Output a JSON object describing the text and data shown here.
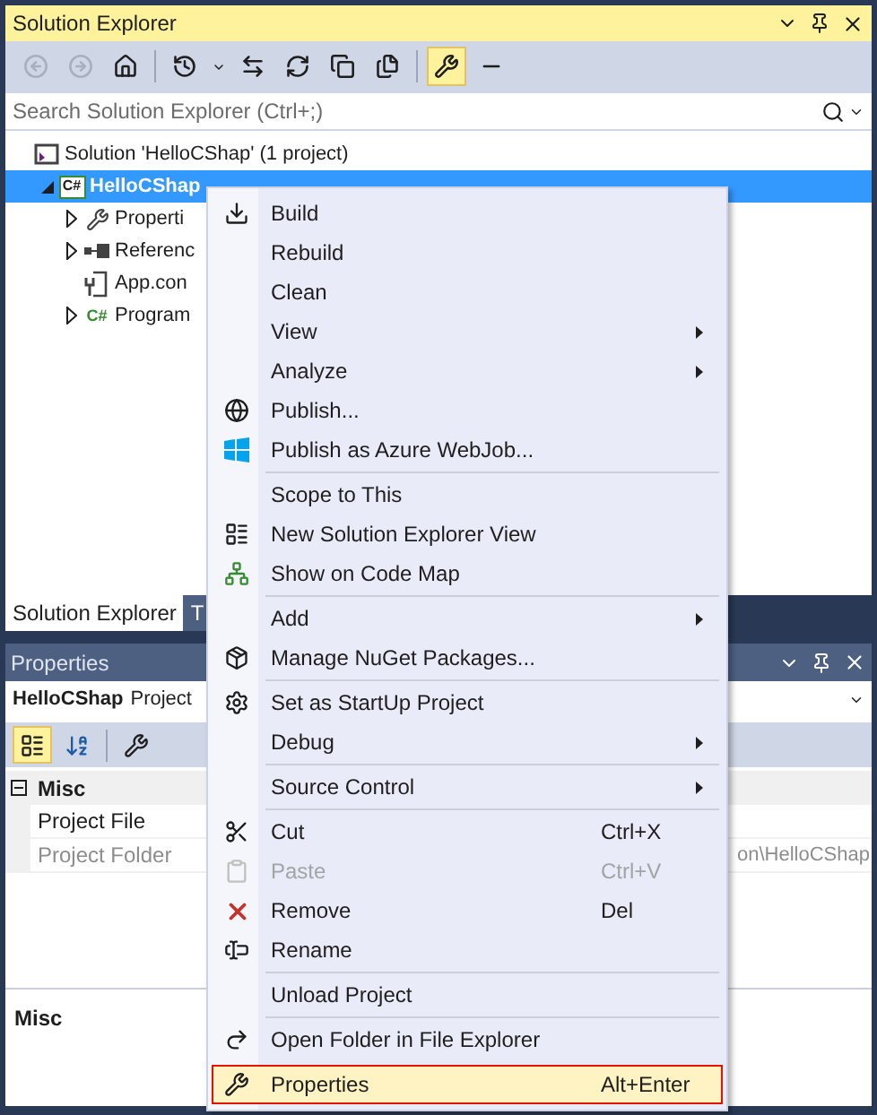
{
  "solution_explorer": {
    "title": "Solution Explorer",
    "toolbar": [
      {
        "disabled": true,
        "selected": false
      },
      {
        "disabled": true,
        "selected": false
      },
      {
        "disabled": false,
        "selected": false
      },
      {
        "disabled": false,
        "selected": false
      },
      {
        "disabled": false,
        "selected": false
      },
      {
        "disabled": false,
        "selected": false
      },
      {
        "disabled": false,
        "selected": false
      },
      {
        "disabled": false,
        "selected": false
      },
      {
        "disabled": false,
        "selected": false
      },
      {
        "disabled": false,
        "selected": true
      },
      {
        "disabled": false,
        "selected": false
      }
    ],
    "search": {
      "placeholder": "Search Solution Explorer (Ctrl+;)"
    },
    "tree": [
      {
        "label": "Solution 'HelloCShap' (1 project)",
        "kind": "solution",
        "selected": false,
        "children": [
          {
            "label": "HelloCShap",
            "kind": "project",
            "badge": "C#",
            "expanded": true,
            "selected": true,
            "children": [
              {
                "label": "Properti",
                "kind": "properties",
                "expanded": false,
                "selected": false
              },
              {
                "label": "Referenc",
                "kind": "references",
                "expanded": false,
                "selected": false
              },
              {
                "label": "App.con",
                "kind": "config",
                "selected": false
              },
              {
                "label": "Program",
                "kind": "csharp",
                "badge": "C#",
                "expanded": false,
                "selected": false
              }
            ]
          }
        ]
      }
    ],
    "tabs": [
      {
        "label": "Solution Explorer",
        "selected": true
      },
      {
        "label": "T",
        "selected": false
      }
    ]
  },
  "properties": {
    "title": "Properties",
    "object_name": "HelloCShap",
    "object_type": "Project",
    "toolbar": [
      {
        "selected": true
      },
      {
        "selected": false
      },
      {
        "selected": false
      }
    ],
    "categories": [
      {
        "label": "Misc",
        "expanded": true,
        "rows": [
          {
            "label": "Project File",
            "value": "",
            "disabled": false
          },
          {
            "label": "Project Folder",
            "value": "on\\HelloCShap",
            "disabled": true
          }
        ]
      }
    ],
    "description_title": "Misc"
  },
  "context_menu": [
    {
      "kind": "item",
      "label": "Build",
      "submenu": false,
      "disabled": false,
      "highlighted": false
    },
    {
      "kind": "item",
      "label": "Rebuild",
      "submenu": false,
      "disabled": false,
      "highlighted": false
    },
    {
      "kind": "item",
      "label": "Clean",
      "submenu": false,
      "disabled": false,
      "highlighted": false
    },
    {
      "kind": "item",
      "label": "View",
      "submenu": true,
      "disabled": false,
      "highlighted": false
    },
    {
      "kind": "item",
      "label": "Analyze",
      "submenu": true,
      "disabled": false,
      "highlighted": false
    },
    {
      "kind": "item",
      "label": "Publish...",
      "submenu": false,
      "disabled": false,
      "highlighted": false
    },
    {
      "kind": "item",
      "label": "Publish as Azure WebJob...",
      "submenu": false,
      "disabled": false,
      "highlighted": false
    },
    {
      "kind": "separator"
    },
    {
      "kind": "item",
      "label": "Scope to This",
      "submenu": false,
      "disabled": false,
      "highlighted": false
    },
    {
      "kind": "item",
      "label": "New Solution Explorer View",
      "submenu": false,
      "disabled": false,
      "highlighted": false
    },
    {
      "kind": "item",
      "label": "Show on Code Map",
      "submenu": false,
      "disabled": false,
      "highlighted": false
    },
    {
      "kind": "separator"
    },
    {
      "kind": "item",
      "label": "Add",
      "submenu": true,
      "disabled": false,
      "highlighted": false
    },
    {
      "kind": "item",
      "label": "Manage NuGet Packages...",
      "submenu": false,
      "disabled": false,
      "highlighted": false
    },
    {
      "kind": "separator"
    },
    {
      "kind": "item",
      "label": "Set as StartUp Project",
      "submenu": false,
      "disabled": false,
      "highlighted": false
    },
    {
      "kind": "item",
      "label": "Debug",
      "submenu": true,
      "disabled": false,
      "highlighted": false
    },
    {
      "kind": "separator"
    },
    {
      "kind": "item",
      "label": "Source Control",
      "submenu": true,
      "disabled": false,
      "highlighted": false
    },
    {
      "kind": "separator"
    },
    {
      "kind": "item",
      "label": "Cut",
      "shortcut": "Ctrl+X",
      "submenu": false,
      "disabled": false,
      "highlighted": false
    },
    {
      "kind": "item",
      "label": "Paste",
      "shortcut": "Ctrl+V",
      "submenu": false,
      "disabled": true,
      "highlighted": false
    },
    {
      "kind": "item",
      "label": "Remove",
      "shortcut": "Del",
      "submenu": false,
      "disabled": false,
      "highlighted": false
    },
    {
      "kind": "item",
      "label": "Rename",
      "submenu": false,
      "disabled": false,
      "highlighted": false
    },
    {
      "kind": "separator"
    },
    {
      "kind": "item",
      "label": "Unload Project",
      "submenu": false,
      "disabled": false,
      "highlighted": false
    },
    {
      "kind": "separator"
    },
    {
      "kind": "item",
      "label": "Open Folder in File Explorer",
      "submenu": false,
      "disabled": false,
      "highlighted": false
    },
    {
      "kind": "item",
      "label": "Properties",
      "shortcut": "Alt+Enter",
      "submenu": false,
      "disabled": false,
      "highlighted": true
    }
  ]
}
